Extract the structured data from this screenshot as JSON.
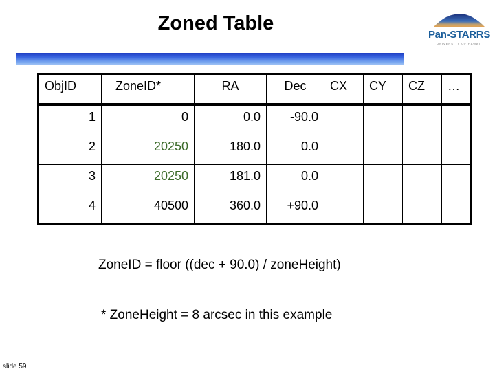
{
  "slide": {
    "title": "Zoned Table",
    "logo": {
      "name": "Pan-STARRS",
      "subtitle": "UNIVERSITY OF HAWAII"
    },
    "slide_number": "slide 59",
    "accent_bar_color": "#2f55d4",
    "highlight_color": "#3c6b2a"
  },
  "table": {
    "headers": [
      "ObjID",
      "ZoneID*",
      "RA",
      "Dec",
      "CX",
      "CY",
      "CZ",
      "…"
    ],
    "rows": [
      {
        "objid": "1",
        "zoneid": "0",
        "ra": "0.0",
        "dec": "-90.0",
        "cx": "",
        "cy": "",
        "cz": "",
        "more": "",
        "highlight": false
      },
      {
        "objid": "2",
        "zoneid": "20250",
        "ra": "180.0",
        "dec": "0.0",
        "cx": "",
        "cy": "",
        "cz": "",
        "more": "",
        "highlight": true
      },
      {
        "objid": "3",
        "zoneid": "20250",
        "ra": "181.0",
        "dec": "0.0",
        "cx": "",
        "cy": "",
        "cz": "",
        "more": "",
        "highlight": true
      },
      {
        "objid": "4",
        "zoneid": "40500",
        "ra": "360.0",
        "dec": "+90.0",
        "cx": "",
        "cy": "",
        "cz": "",
        "more": "",
        "highlight": false
      }
    ]
  },
  "formula": "ZoneID = floor ((dec + 90.0) / zoneHeight)",
  "note": "* ZoneHeight = 8 arcsec in this example"
}
